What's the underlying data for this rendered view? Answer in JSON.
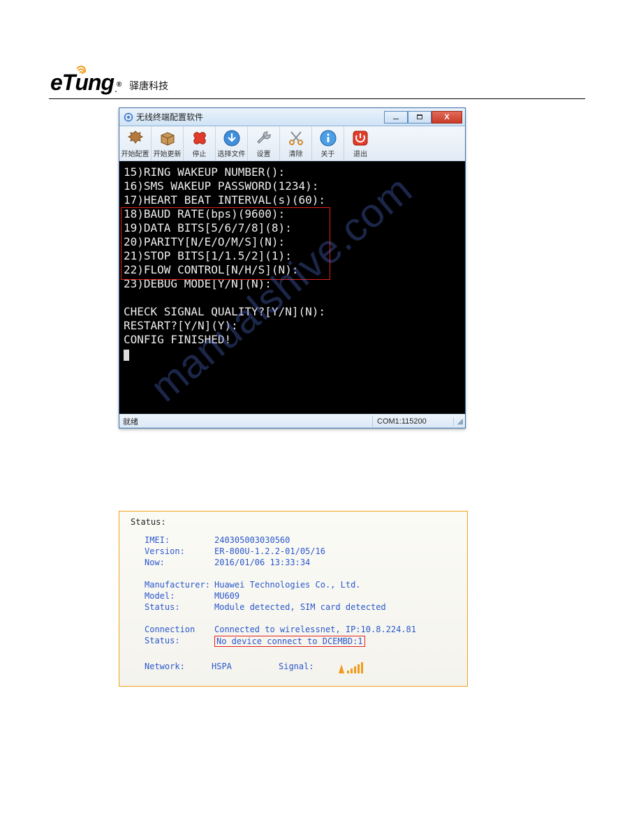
{
  "header": {
    "logo_text": "eTung",
    "company": "驿唐科技"
  },
  "watermark": "manualshive.com",
  "app": {
    "title": "无线终端配置软件",
    "toolbar": [
      {
        "name": "start-config",
        "label": "开始配置"
      },
      {
        "name": "start-update",
        "label": "开始更新"
      },
      {
        "name": "stop",
        "label": "停止"
      },
      {
        "name": "choose-file",
        "label": "选择文件"
      },
      {
        "name": "settings",
        "label": "设置"
      },
      {
        "name": "clear",
        "label": "清除"
      },
      {
        "name": "about",
        "label": "关于"
      },
      {
        "name": "exit",
        "label": "退出"
      }
    ],
    "console_lines": [
      "15)RING WAKEUP NUMBER():",
      "16)SMS WAKEUP PASSWORD(1234):",
      "17)HEART BEAT INTERVAL(s)(60):",
      "18)BAUD RATE(bps)(9600):",
      "19)DATA BITS[5/6/7/8](8):",
      "20)PARITY[N/E/O/M/S](N):",
      "21)STOP BITS[1/1.5/2](1):",
      "22)FLOW CONTROL[N/H/S](N):",
      "23)DEBUG MODE[Y/N](N):",
      "",
      "CHECK SIGNAL QUALITY?[Y/N](N):",
      "RESTART?[Y/N](Y):",
      "CONFIG FINISHED!"
    ],
    "statusbar": {
      "left": "就绪",
      "right": "COM1:115200"
    }
  },
  "status_panel": {
    "heading": "Status:",
    "imei": {
      "label": "IMEI:",
      "value": "240305003030560"
    },
    "version": {
      "label": "Version:",
      "value": "ER-800U-1.2.2-01/05/16"
    },
    "now": {
      "label": "Now:",
      "value": "2016/01/06 13:33:34"
    },
    "manufacturer": {
      "label": "Manufacturer:",
      "value": "Huawei Technologies Co., Ltd."
    },
    "model": {
      "label": "Model:",
      "value": "MU609"
    },
    "mstatus": {
      "label": "Status:",
      "value": "Module detected, SIM card detected"
    },
    "connection": {
      "label": "Connection",
      "value": "Connected to wirelessnet, IP:10.8.224.81"
    },
    "cstatus": {
      "label": "Status:",
      "value": "No device connect to DCEMBD:1"
    },
    "network": {
      "label": "Network:",
      "value": "HSPA",
      "signal_label": "Signal:"
    }
  }
}
